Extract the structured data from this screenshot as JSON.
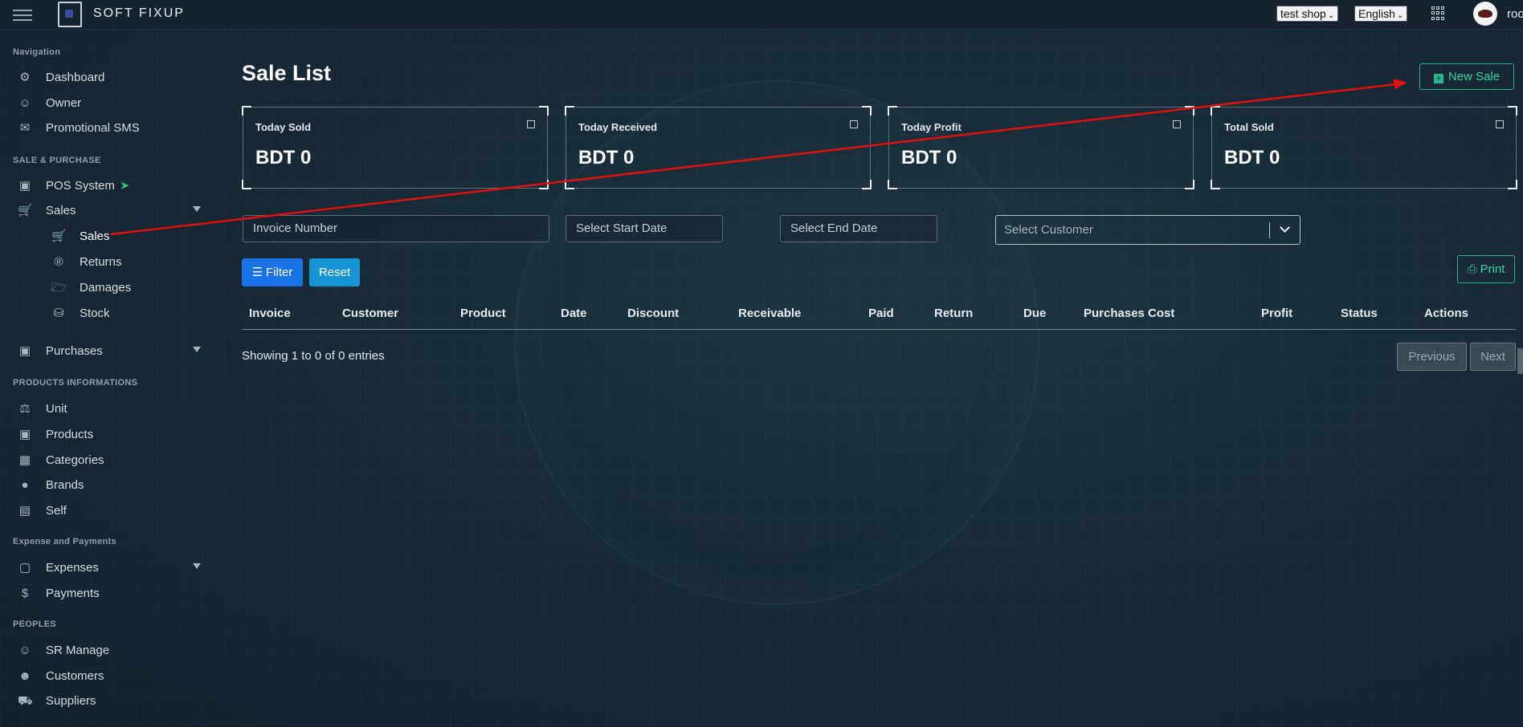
{
  "topbar": {
    "brand": "SOFT FIXUP",
    "shop_select": "test shop",
    "language_select": "English",
    "user_name": "roo"
  },
  "sidebar": {
    "sections": {
      "navigation": "Navigation",
      "sale_purchase": "SALE & PURCHASE",
      "products_info": "PRODUCTS INFORMATIONS",
      "expense_payments": "Expense and Payments",
      "peoples": "PEOPLES"
    },
    "items": {
      "dashboard": "Dashboard",
      "owner": "Owner",
      "promotional_sms": "Promotional SMS",
      "pos_system": "POS System",
      "sales": "Sales",
      "sales_sub": "Sales",
      "returns": "Returns",
      "damages": "Damages",
      "stock": "Stock",
      "purchases": "Purchases",
      "unit": "Unit",
      "products": "Products",
      "categories": "Categories",
      "brands": "Brands",
      "self": "Self",
      "expenses": "Expenses",
      "payments": "Payments",
      "sr_manage": "SR Manage",
      "customers": "Customers",
      "suppliers": "Suppliers"
    }
  },
  "main": {
    "title": "Sale List",
    "new_sale_label": "New Sale",
    "cards": [
      {
        "title": "Today Sold",
        "value": "BDT 0"
      },
      {
        "title": "Today Received",
        "value": "BDT 0"
      },
      {
        "title": "Today Profit",
        "value": "BDT 0"
      },
      {
        "title": "Total Sold",
        "value": "BDT 0"
      }
    ],
    "filters": {
      "invoice_placeholder": "Invoice Number",
      "start_date_placeholder": "Select Start Date",
      "end_date_placeholder": "Select End Date",
      "customer_placeholder": "Select Customer",
      "filter_label": "Filter",
      "reset_label": "Reset",
      "print_label": "Print"
    },
    "table": {
      "columns": [
        "Invoice",
        "Customer",
        "Product",
        "Date",
        "Discount",
        "Receivable",
        "Paid",
        "Return",
        "Due",
        "Purchases Cost",
        "Profit",
        "Status",
        "Actions"
      ],
      "info": "Showing 1 to 0 of 0 entries",
      "previous": "Previous",
      "next": "Next"
    }
  },
  "colors": {
    "accent_green": "#2bb58a",
    "filter_blue": "#1a74e8",
    "reset_blue": "#1595d4",
    "annotation_red": "#e01010"
  }
}
